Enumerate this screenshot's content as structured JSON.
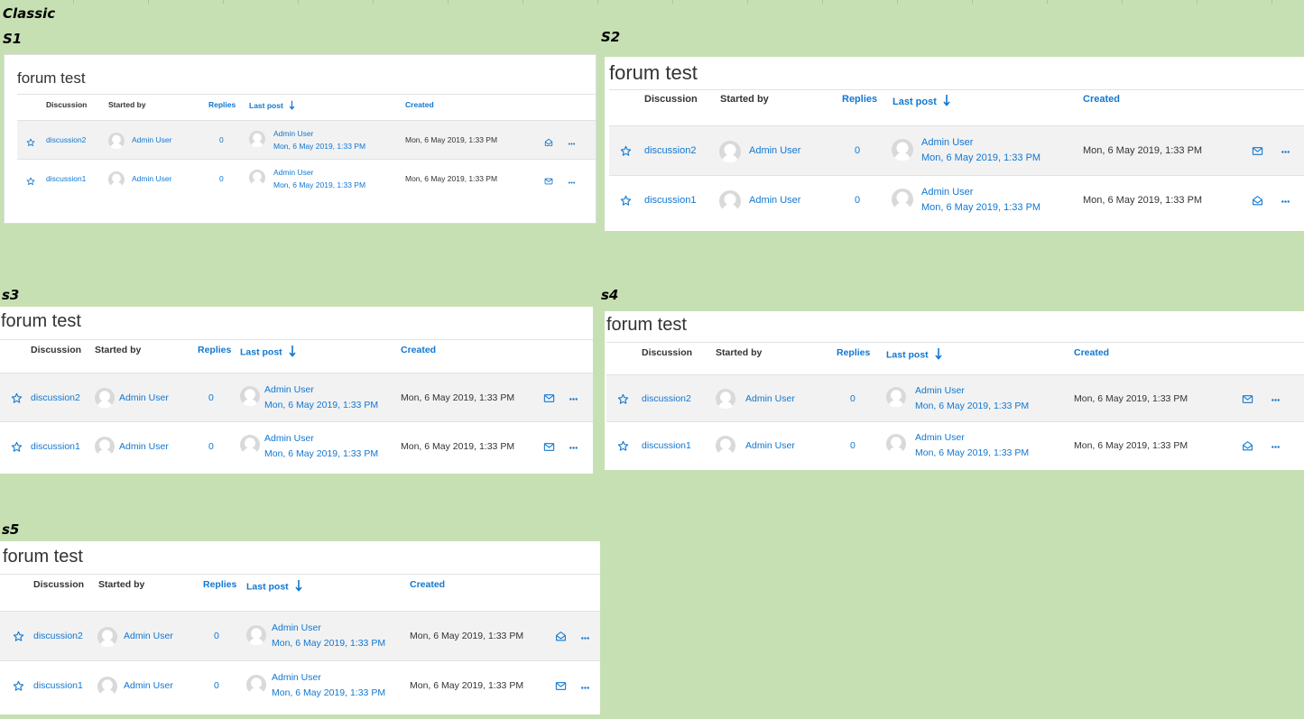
{
  "classic_label": "Classic",
  "panels": [
    {
      "label": "S1",
      "title": "forum test",
      "columns": {
        "discussion": "Discussion",
        "started_by": "Started by",
        "replies": "Replies",
        "last_post": "Last post",
        "created": "Created"
      },
      "rows": [
        {
          "discussion": "discussion2",
          "author": "Admin User",
          "replies": "0",
          "last_author": "Admin User",
          "last_date": "Mon, 6 May 2019, 1:33 PM",
          "created": "Mon, 6 May 2019, 1:33 PM",
          "mail_icon": "envelope-open-icon",
          "shaded": true
        },
        {
          "discussion": "discussion1",
          "author": "Admin User",
          "replies": "0",
          "last_author": "Admin User",
          "last_date": "Mon, 6 May 2019, 1:33 PM",
          "created": "Mon, 6 May 2019, 1:33 PM",
          "mail_icon": "envelope-icon",
          "shaded": false
        }
      ]
    },
    {
      "label": "S2",
      "title": "forum test",
      "columns": {
        "discussion": "Discussion",
        "started_by": "Started by",
        "replies": "Replies",
        "last_post": "Last post",
        "created": "Created"
      },
      "rows": [
        {
          "discussion": "discussion2",
          "author": "Admin User",
          "replies": "0",
          "last_author": "Admin User",
          "last_date": "Mon, 6 May 2019, 1:33 PM",
          "created": "Mon, 6 May 2019, 1:33 PM",
          "mail_icon": "envelope-icon",
          "shaded": true
        },
        {
          "discussion": "discussion1",
          "author": "Admin User",
          "replies": "0",
          "last_author": "Admin User",
          "last_date": "Mon, 6 May 2019, 1:33 PM",
          "created": "Mon, 6 May 2019, 1:33 PM",
          "mail_icon": "envelope-open-icon",
          "shaded": false
        }
      ]
    },
    {
      "label": "s3",
      "title": "forum test",
      "columns": {
        "discussion": "Discussion",
        "started_by": "Started by",
        "replies": "Replies",
        "last_post": "Last post",
        "created": "Created"
      },
      "rows": [
        {
          "discussion": "discussion2",
          "author": "Admin User",
          "replies": "0",
          "last_author": "Admin User",
          "last_date": "Mon, 6 May 2019, 1:33 PM",
          "created": "Mon, 6 May 2019, 1:33 PM",
          "mail_icon": "envelope-icon",
          "shaded": true
        },
        {
          "discussion": "discussion1",
          "author": "Admin User",
          "replies": "0",
          "last_author": "Admin User",
          "last_date": "Mon, 6 May 2019, 1:33 PM",
          "created": "Mon, 6 May 2019, 1:33 PM",
          "mail_icon": "envelope-icon",
          "shaded": false
        }
      ]
    },
    {
      "label": "s4",
      "title": "forum test",
      "columns": {
        "discussion": "Discussion",
        "started_by": "Started by",
        "replies": "Replies",
        "last_post": "Last post",
        "created": "Created"
      },
      "rows": [
        {
          "discussion": "discussion2",
          "author": "Admin User",
          "replies": "0",
          "last_author": "Admin User",
          "last_date": "Mon, 6 May 2019, 1:33 PM",
          "created": "Mon, 6 May 2019, 1:33 PM",
          "mail_icon": "envelope-icon",
          "shaded": true
        },
        {
          "discussion": "discussion1",
          "author": "Admin User",
          "replies": "0",
          "last_author": "Admin User",
          "last_date": "Mon, 6 May 2019, 1:33 PM",
          "created": "Mon, 6 May 2019, 1:33 PM",
          "mail_icon": "envelope-open-icon",
          "shaded": false
        }
      ]
    },
    {
      "label": "s5",
      "title": "forum test",
      "columns": {
        "discussion": "Discussion",
        "started_by": "Started by",
        "replies": "Replies",
        "last_post": "Last post",
        "created": "Created"
      },
      "rows": [
        {
          "discussion": "discussion2",
          "author": "Admin User",
          "replies": "0",
          "last_author": "Admin User",
          "last_date": "Mon, 6 May 2019, 1:33 PM",
          "created": "Mon, 6 May 2019, 1:33 PM",
          "mail_icon": "envelope-open-icon",
          "shaded": true
        },
        {
          "discussion": "discussion1",
          "author": "Admin User",
          "replies": "0",
          "last_author": "Admin User",
          "last_date": "Mon, 6 May 2019, 1:33 PM",
          "created": "Mon, 6 May 2019, 1:33 PM",
          "mail_icon": "envelope-icon",
          "shaded": false
        }
      ]
    }
  ],
  "colors": {
    "link": "#1177d1",
    "text": "#333333",
    "background": "#c6e0b4",
    "row_shade": "#f2f2f2"
  },
  "icons": {
    "star": "star-outline-icon",
    "avatar": "default-avatar-icon",
    "menu": "ellipsis-icon",
    "sort": "sort-down-arrow-icon"
  }
}
